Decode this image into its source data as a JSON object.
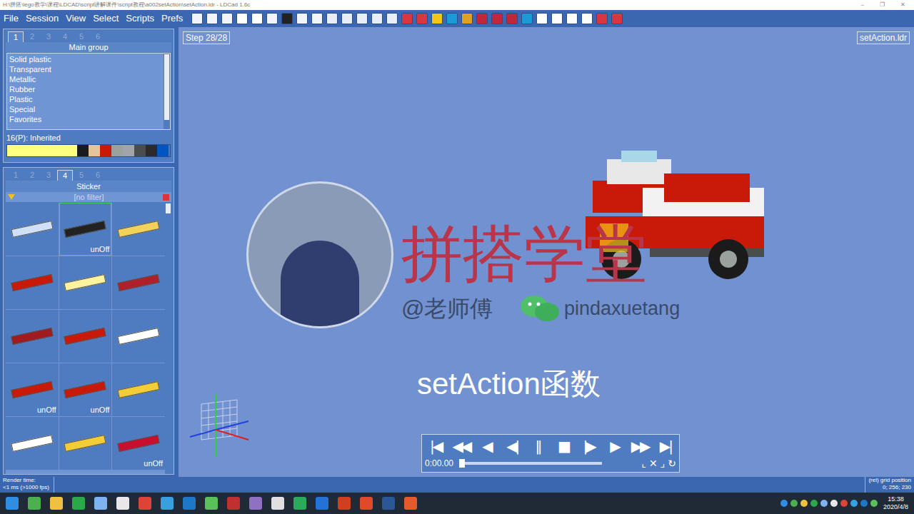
{
  "window": {
    "title": "H:\\拼搭\\lego教学\\课程\\LDCAD\\script讲解课件\\script教程\\a002setAction\\setAction.ldr - LDCad 1.6c",
    "controls": [
      "–",
      "❐",
      "✕"
    ]
  },
  "menu": [
    "File",
    "Session",
    "View",
    "Select",
    "Scripts",
    "Prefs"
  ],
  "top_panel": {
    "tabs": [
      {
        "label": "1",
        "selected": true
      },
      {
        "label": "2",
        "selected": false
      },
      {
        "label": "3",
        "selected": false
      },
      {
        "label": "4",
        "selected": false
      },
      {
        "label": "5",
        "selected": false
      },
      {
        "label": "6",
        "selected": false
      }
    ],
    "title": "Main group",
    "items": [
      "Solid plastic",
      "Transparent",
      "Metallic",
      "Rubber",
      "Plastic",
      "Special",
      "Favorites"
    ],
    "current_color": "16(P): Inherited",
    "swatches": [
      {
        "color": "#ffff80"
      },
      {
        "color": "#1b1b1b"
      },
      {
        "color": "#e5c49a"
      },
      {
        "color": "#c91a09"
      },
      {
        "color": "#9ba19d"
      },
      {
        "color": "#a0a5a9"
      },
      {
        "color": "#4a4d4e"
      },
      {
        "color": "#2b2b2b"
      },
      {
        "color": "#0055bf"
      }
    ]
  },
  "bottom_panel": {
    "tabs": [
      {
        "label": "1",
        "selected": false
      },
      {
        "label": "2",
        "selected": false
      },
      {
        "label": "3",
        "selected": false
      },
      {
        "label": "4",
        "selected": true
      },
      {
        "label": "5",
        "selected": false
      },
      {
        "label": "6",
        "selected": false
      }
    ],
    "title": "Sticker",
    "filter": "[no filter]",
    "parts": [
      {
        "label": "",
        "selected": false,
        "color": "#cfe0f7"
      },
      {
        "label": "unOff",
        "selected": true,
        "color": "#222222"
      },
      {
        "label": "",
        "selected": false,
        "color": "#f2d25a"
      },
      {
        "label": "",
        "selected": false,
        "color": "#c91a09"
      },
      {
        "label": "",
        "selected": false,
        "color": "#fff3a0"
      },
      {
        "label": "",
        "selected": false,
        "color": "#b0202a"
      },
      {
        "label": "",
        "selected": false,
        "color": "#a01a20"
      },
      {
        "label": "",
        "selected": false,
        "color": "#c91a09"
      },
      {
        "label": "",
        "selected": false,
        "color": "#ffffff"
      },
      {
        "label": "unOff",
        "selected": false,
        "color": "#c91a09"
      },
      {
        "label": "unOff",
        "selected": false,
        "color": "#c91a09"
      },
      {
        "label": "",
        "selected": false,
        "color": "#f2cd37"
      },
      {
        "label": "",
        "selected": false,
        "color": "#ffffff"
      },
      {
        "label": "",
        "selected": false,
        "color": "#f2cd37"
      },
      {
        "label": "unOff",
        "selected": false,
        "color": "#c8102e"
      }
    ]
  },
  "viewport": {
    "step": "Step 28/28",
    "file": "setAction.ldr",
    "overlay": {
      "brand": "拼搭学堂",
      "author": "@老师傅",
      "wechat": "pindaxuetang",
      "topic": "setAction函数"
    }
  },
  "player": {
    "buttons": [
      "|◀",
      "◀◀",
      "◀",
      "◀|",
      "‖",
      "■",
      "|▶",
      "▶",
      "▶▶",
      "▶|"
    ],
    "time": "0:00.00",
    "level": 0,
    "tools": [
      "⌞",
      "✕",
      "⌟",
      "↻"
    ]
  },
  "status_bar": {
    "left_label": "Render time:",
    "left_value": "<1 ms (>1000 fps)",
    "right_label": "(rel) grid position",
    "right_value": "0; 256; 230"
  },
  "taskbar": {
    "time": "15:38",
    "date": "2020/4/8"
  }
}
